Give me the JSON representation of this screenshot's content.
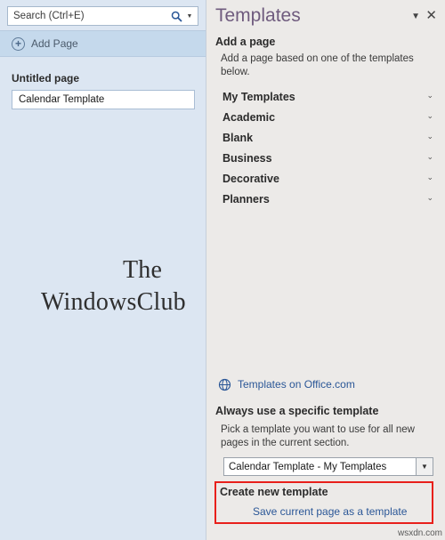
{
  "left": {
    "search": {
      "placeholder": "Search (Ctrl+E)",
      "value": "",
      "icon": "search-icon",
      "dropdown_icon": "caret-down-icon"
    },
    "add_page": {
      "label": "Add Page",
      "icon": "plus-circle-icon"
    },
    "section_title": "Untitled page",
    "pages": [
      {
        "label": "Calendar Template"
      }
    ],
    "watermark": {
      "line1": "The",
      "line2": "WindowsClub",
      "logo": "windows-logo-icon"
    }
  },
  "right": {
    "title": "Templates",
    "collapse_icon": "chevron-down-icon",
    "close_icon": "close-icon",
    "add_a_page": {
      "heading": "Add a page",
      "description": "Add a page based on one of the templates below."
    },
    "categories": [
      {
        "label": "My Templates",
        "chevron": "chevron-down-icon"
      },
      {
        "label": "Academic",
        "chevron": "chevron-down-icon"
      },
      {
        "label": "Blank",
        "chevron": "chevron-down-icon"
      },
      {
        "label": "Business",
        "chevron": "chevron-down-icon"
      },
      {
        "label": "Decorative",
        "chevron": "chevron-down-icon"
      },
      {
        "label": "Planners",
        "chevron": "chevron-down-icon"
      }
    ],
    "office_link": {
      "label": "Templates on Office.com",
      "icon": "globe-icon"
    },
    "always_use": {
      "heading": "Always use a specific template",
      "description": "Pick a template you want to use for all new pages in the current section.",
      "selected": "Calendar Template - My Templates",
      "dropdown_icon": "caret-down-icon"
    },
    "create_new": {
      "heading": "Create new template",
      "link": "Save current page as a template",
      "highlight_color": "#e8201b"
    }
  },
  "footer": {
    "watermark": "wsxdn.com"
  }
}
